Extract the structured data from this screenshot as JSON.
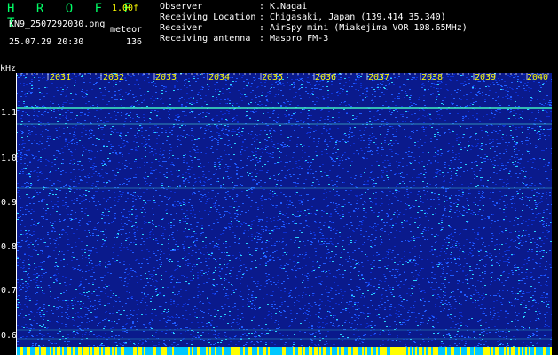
{
  "header": {
    "app_title": "H R O F F T",
    "version": "1.00f",
    "filename": "KN9_2507292030.png",
    "meteor_label": "meteor",
    "datetime": "25.07.29 20:30",
    "count": "136"
  },
  "info": [
    {
      "key": "Observer",
      "value": "K.Nagai"
    },
    {
      "key": "Receiving Location",
      "value": "Chigasaki, Japan (139.414 35.340)"
    },
    {
      "key": "Receiver",
      "value": "AirSpy mini (Miakejima VOR 108.65MHz)"
    },
    {
      "key": "Receiving antenna",
      "value": "Maspro FM-3"
    }
  ],
  "y_axis": {
    "unit": "kHz",
    "ticks": [
      "1.1",
      "1.0",
      "0.9",
      "0.8",
      "0.7",
      "0.6"
    ]
  },
  "time_ticks": [
    "2031",
    "2032",
    "2033",
    "2034",
    "2035",
    "2036",
    "2037",
    "2038",
    "2039",
    "2040"
  ],
  "colors": {
    "background": "#000000",
    "spectrogram_base": "#0a1a8c",
    "noise_dot": "#1f5cff",
    "noise_dot_bright": "#28d3ff",
    "carrier_line": "#40f0c0",
    "tick_label": "#ffff00",
    "title": "#00ff66",
    "text": "#ffffff",
    "bottom_strip": "#ffff00"
  }
}
